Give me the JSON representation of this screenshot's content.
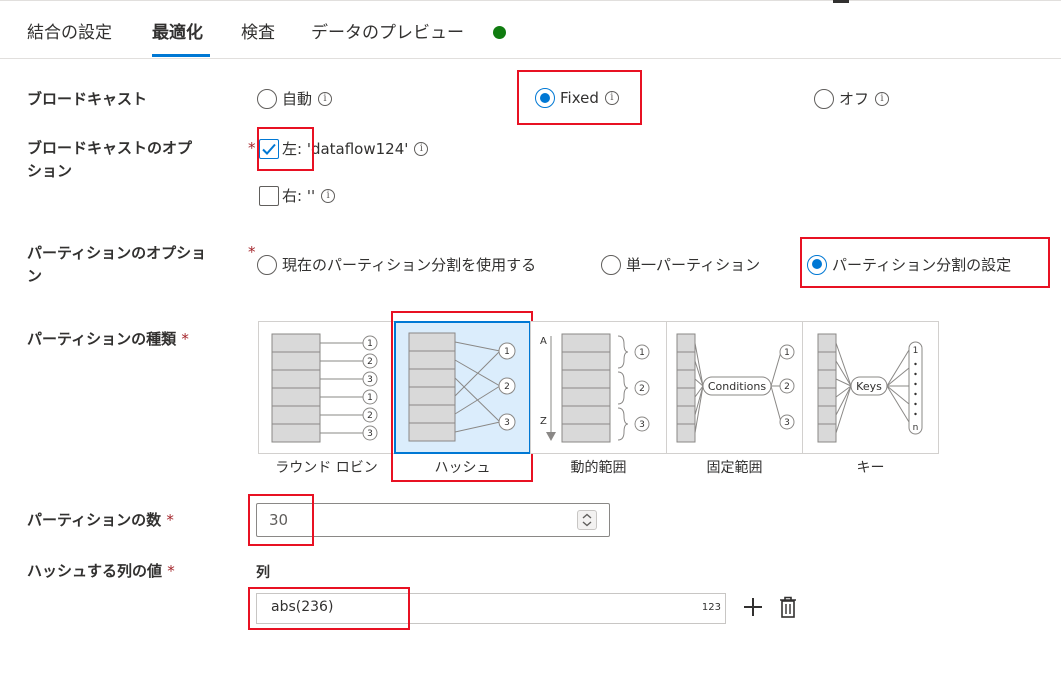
{
  "tabs": [
    {
      "label": "結合の設定"
    },
    {
      "label": "最適化"
    },
    {
      "label": "検査"
    },
    {
      "label": "データのプレビュー"
    }
  ],
  "active_tab": "最適化",
  "status_color": "#107c10",
  "broadcast": {
    "label": "ブロードキャスト",
    "options": [
      {
        "label": "自動",
        "selected": false
      },
      {
        "label": "Fixed",
        "selected": true
      },
      {
        "label": "オフ",
        "selected": false
      }
    ]
  },
  "broadcast_options": {
    "label_line1": "ブロードキャストのオプ",
    "label_line2": "ション",
    "required": "*",
    "left": {
      "label": "左: 'dataflow124'",
      "checked": true
    },
    "right": {
      "label": "右: ''",
      "checked": false
    }
  },
  "partition_option": {
    "label_line1": "パーティションのオプショ",
    "label_line2": "ン",
    "required": "*",
    "options": [
      {
        "label": "現在のパーティション分割を使用する",
        "selected": false
      },
      {
        "label": "単一パーティション",
        "selected": false
      },
      {
        "label": "パーティション分割の設定",
        "selected": true
      }
    ]
  },
  "partition_type": {
    "label": "パーティションの種類",
    "required": "*",
    "types": [
      {
        "label": "ラウンド ロビン",
        "selected": false
      },
      {
        "label": "ハッシュ",
        "selected": true
      },
      {
        "label": "動的範囲",
        "selected": false
      },
      {
        "label": "固定範囲",
        "selected": false
      },
      {
        "label": "キー",
        "selected": false
      }
    ],
    "diagram_text": {
      "rr_numbers": [
        "1",
        "2",
        "3",
        "1",
        "2",
        "3"
      ],
      "hash_numbers": [
        "1",
        "2",
        "3"
      ],
      "range_numbers": [
        "1",
        "2",
        "3"
      ],
      "range_axis_top": "A",
      "range_axis_bottom": "Z",
      "conditions": "Conditions",
      "fixed_numbers": [
        "1",
        "2",
        "3"
      ],
      "keys": "Keys",
      "key_top": "1",
      "key_bottom": "n"
    }
  },
  "partition_count": {
    "label": "パーティションの数",
    "required": "*",
    "value": "30"
  },
  "hash_columns": {
    "label": "ハッシュする列の値",
    "required": "*",
    "column_header": "列",
    "value": "abs(236)",
    "type_badge": "123"
  },
  "colors": {
    "accent": "#0078d4",
    "highlight_border": "#e81123",
    "selected_bg": "#dbedfc"
  },
  "icons": [
    "info-icon",
    "checkmark-icon",
    "spin-button-icon",
    "add-icon",
    "delete-icon"
  ]
}
